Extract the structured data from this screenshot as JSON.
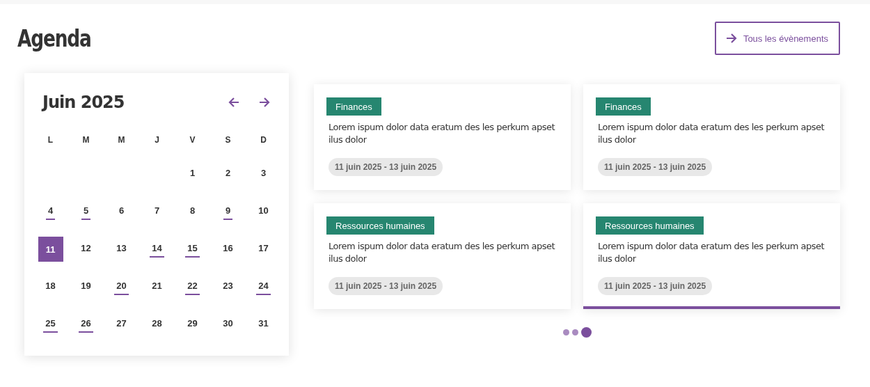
{
  "header": {
    "title": "Agenda",
    "button": "Tous les évènements"
  },
  "calendar": {
    "month": "Juin 2025",
    "weekdays": [
      "L",
      "M",
      "M",
      "J",
      "V",
      "S",
      "D"
    ],
    "weeks": [
      {
        "days": [
          {
            "label": "1",
            "marked": false,
            "selected": false
          },
          {
            "label": "2",
            "marked": false,
            "selected": false
          },
          {
            "label": "3",
            "marked": false,
            "selected": false
          }
        ]
      },
      {
        "days": [
          {
            "label": "4",
            "marked": true,
            "selected": false
          },
          {
            "label": "5",
            "marked": true,
            "selected": false
          },
          {
            "label": "6",
            "marked": false,
            "selected": false
          },
          {
            "label": "7",
            "marked": false,
            "selected": false
          },
          {
            "label": "8",
            "marked": false,
            "selected": false
          },
          {
            "label": "9",
            "marked": true,
            "selected": false
          },
          {
            "label": "10",
            "marked": false,
            "selected": false
          }
        ]
      },
      {
        "days": [
          {
            "label": "11",
            "marked": false,
            "selected": true
          },
          {
            "label": "12",
            "marked": false,
            "selected": false
          },
          {
            "label": "13",
            "marked": false,
            "selected": false
          },
          {
            "label": "14",
            "marked": true,
            "selected": false
          },
          {
            "label": "15",
            "marked": true,
            "selected": false
          },
          {
            "label": "16",
            "marked": false,
            "selected": false
          },
          {
            "label": "17",
            "marked": false,
            "selected": false
          }
        ]
      },
      {
        "days": [
          {
            "label": "18",
            "marked": false,
            "selected": false
          },
          {
            "label": "19",
            "marked": false,
            "selected": false
          },
          {
            "label": "20",
            "marked": true,
            "selected": false
          },
          {
            "label": "21",
            "marked": false,
            "selected": false
          },
          {
            "label": "22",
            "marked": true,
            "selected": false
          },
          {
            "label": "23",
            "marked": false,
            "selected": false
          },
          {
            "label": "24",
            "marked": true,
            "selected": false
          }
        ]
      },
      {
        "days": [
          {
            "label": "25",
            "marked": true,
            "selected": false
          },
          {
            "label": "26",
            "marked": true,
            "selected": false
          },
          {
            "label": "27",
            "marked": false,
            "selected": false
          },
          {
            "label": "28",
            "marked": false,
            "selected": false
          },
          {
            "label": "29",
            "marked": false,
            "selected": false
          },
          {
            "label": "30",
            "marked": false,
            "selected": false
          },
          {
            "label": "31",
            "marked": false,
            "selected": false
          }
        ]
      }
    ]
  },
  "events": [
    {
      "tag": "Finances",
      "text": "Lorem ispum dolor data eratum des les perkum apset ilus dolor",
      "dates": "11 juin 2025 - 13 juin 2025",
      "selected": false
    },
    {
      "tag": "Finances",
      "text": "Lorem ispum dolor data eratum des les perkum apset ilus dolor",
      "dates": "11 juin 2025 - 13 juin 2025",
      "selected": false
    },
    {
      "tag": "Ressources humaines",
      "text": "Lorem ispum dolor data eratum des les perkum apset ilus dolor",
      "dates": "11 juin 2025 - 13 juin 2025",
      "selected": false
    },
    {
      "tag": "Ressources humaines",
      "text": "Lorem ispum dolor data eratum des les perkum apset ilus dolor",
      "dates": "11 juin 2025 - 13 juin 2025",
      "selected": true
    }
  ],
  "pager": [
    {
      "selected": false
    },
    {
      "selected": false
    },
    {
      "selected": true
    }
  ]
}
